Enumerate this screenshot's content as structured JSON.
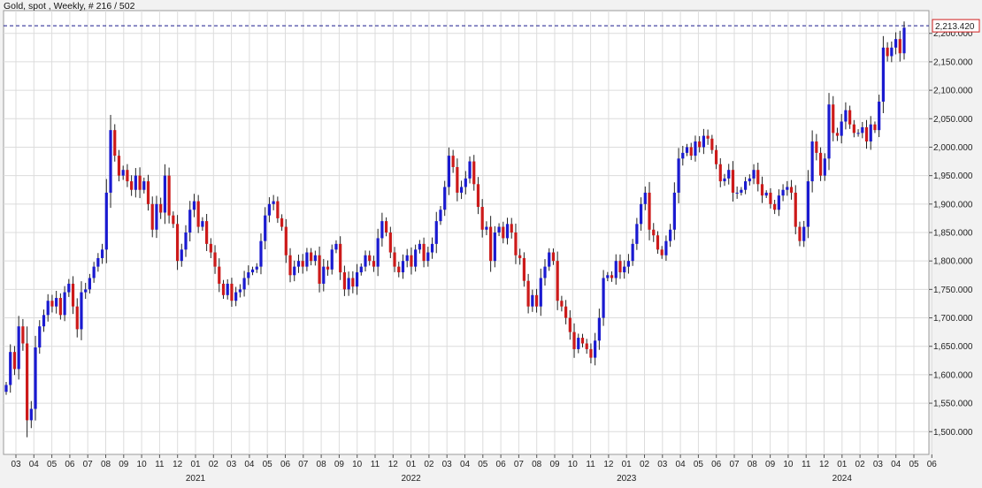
{
  "window": {
    "title": "Gold, spot , Weekly, # 216 / 502"
  },
  "price_badge": {
    "label": "2,213.420"
  },
  "colors": {
    "up": "#1a1ad0",
    "down": "#cc1a1a",
    "wick": "#222222",
    "grid": "#dcdcdc",
    "reference_line": "#1a1a8c",
    "badge_border": "#d12020",
    "background": "#ffffff",
    "frame": "#f2f2f2"
  },
  "chart_data": {
    "type": "candlestick",
    "title": "Gold, spot , Weekly, # 216 / 502",
    "xlabel": "",
    "ylabel": "",
    "ylim": [
      1460,
      2240
    ],
    "y_ticks": [
      1500,
      1550,
      1600,
      1650,
      1700,
      1750,
      1800,
      1850,
      1900,
      1950,
      2000,
      2050,
      2100,
      2150,
      2200
    ],
    "y_tick_labels": [
      "1,500.000",
      "1,550.000",
      "1,600.000",
      "1,650.000",
      "1,700.000",
      "1,750.000",
      "1,800.000",
      "1,850.000",
      "1,900.000",
      "1,950.000",
      "2,000.000",
      "2,050.000",
      "2,100.000",
      "2,150.000",
      "2,200.000"
    ],
    "x_month_labels": [
      "03",
      "04",
      "05",
      "06",
      "07",
      "08",
      "09",
      "10",
      "11",
      "12",
      "01",
      "02",
      "03",
      "04",
      "05",
      "06",
      "07",
      "08",
      "09",
      "10",
      "11",
      "12",
      "01",
      "02",
      "03",
      "04",
      "05",
      "06",
      "07",
      "08",
      "09",
      "10",
      "11",
      "12",
      "01",
      "02",
      "03",
      "04",
      "05",
      "06",
      "07",
      "08",
      "09",
      "10",
      "11",
      "12",
      "01",
      "02",
      "03",
      "04",
      "05",
      "06"
    ],
    "x_year_labels": [
      {
        "label": "2021",
        "month_index": 10
      },
      {
        "label": "2022",
        "month_index": 22
      },
      {
        "label": "2023",
        "month_index": 34
      },
      {
        "label": "2024",
        "month_index": 46
      }
    ],
    "reference_line": 2213.42,
    "grid": true,
    "legend": "none",
    "weeks_per_month": 4.3,
    "close": [
      1582,
      1640,
      1610,
      1685,
      1655,
      1520,
      1540,
      1648,
      1685,
      1705,
      1730,
      1720,
      1735,
      1705,
      1745,
      1760,
      1720,
      1680,
      1745,
      1750,
      1770,
      1790,
      1805,
      1820,
      1920,
      2030,
      1985,
      1950,
      1960,
      1940,
      1925,
      1950,
      1925,
      1940,
      1900,
      1855,
      1900,
      1885,
      1950,
      1880,
      1865,
      1800,
      1820,
      1850,
      1890,
      1905,
      1860,
      1870,
      1830,
      1815,
      1790,
      1760,
      1740,
      1760,
      1730,
      1745,
      1750,
      1770,
      1780,
      1785,
      1790,
      1835,
      1880,
      1900,
      1905,
      1875,
      1860,
      1810,
      1775,
      1790,
      1800,
      1790,
      1815,
      1800,
      1810,
      1760,
      1790,
      1785,
      1820,
      1830,
      1780,
      1750,
      1770,
      1755,
      1780,
      1790,
      1810,
      1800,
      1790,
      1840,
      1870,
      1850,
      1815,
      1790,
      1780,
      1800,
      1810,
      1790,
      1820,
      1830,
      1800,
      1815,
      1830,
      1870,
      1890,
      1930,
      1985,
      1965,
      1920,
      1930,
      1945,
      1975,
      1935,
      1895,
      1855,
      1860,
      1800,
      1850,
      1860,
      1840,
      1865,
      1850,
      1810,
      1805,
      1765,
      1720,
      1740,
      1720,
      1770,
      1790,
      1815,
      1800,
      1730,
      1720,
      1700,
      1675,
      1645,
      1665,
      1655,
      1645,
      1630,
      1660,
      1700,
      1770,
      1775,
      1770,
      1800,
      1780,
      1790,
      1800,
      1830,
      1865,
      1900,
      1920,
      1855,
      1845,
      1820,
      1810,
      1835,
      1855,
      1920,
      1980,
      1990,
      2000,
      1985,
      2010,
      2000,
      2020,
      2015,
      1995,
      1970,
      1940,
      1945,
      1960,
      1920,
      1920,
      1925,
      1940,
      1945,
      1960,
      1935,
      1915,
      1920,
      1900,
      1890,
      1915,
      1925,
      1930,
      1920,
      1860,
      1835,
      1860,
      1940,
      2010,
      1990,
      1950,
      1980,
      2075,
      2025,
      2020,
      2045,
      2065,
      2040,
      2025,
      2025,
      2035,
      2010,
      2040,
      2030,
      2080,
      2175,
      2160,
      2175,
      2190,
      2165,
      2210
    ],
    "values_note": ""
  }
}
